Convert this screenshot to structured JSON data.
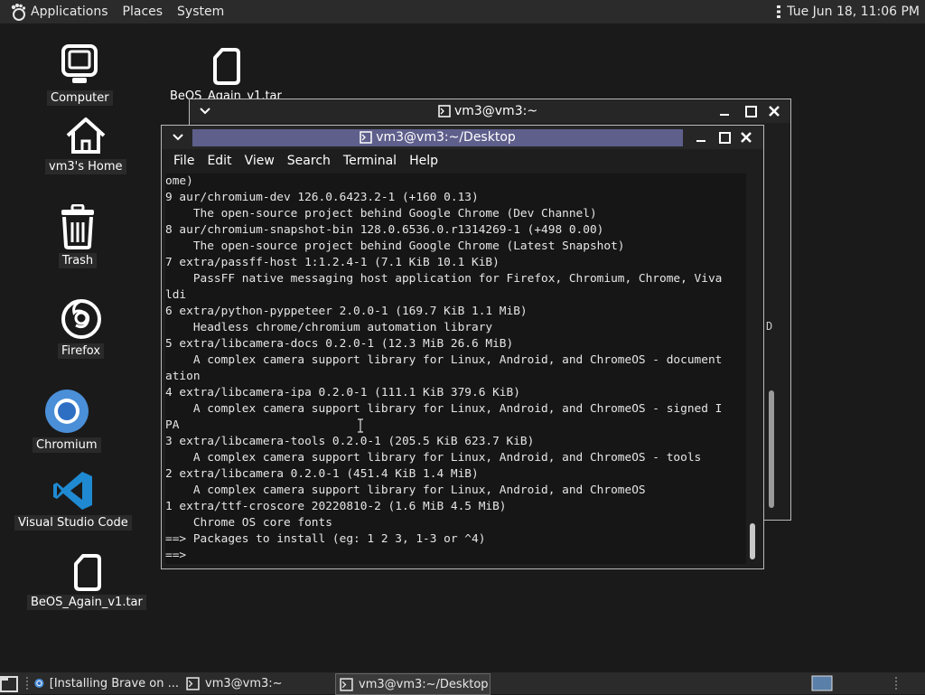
{
  "top_panel": {
    "menus": [
      "Applications",
      "Places",
      "System"
    ],
    "clock": "Tue Jun 18, 11:06 PM"
  },
  "desktop_icons": [
    {
      "label": "Computer",
      "icon": "computer-icon"
    },
    {
      "label": "BeOS_Again_v1.tar",
      "icon": "archive-file-icon"
    },
    {
      "label": "vm3's Home",
      "icon": "home-folder-icon"
    },
    {
      "label": "Trash",
      "icon": "trash-icon"
    },
    {
      "label": "Firefox",
      "icon": "firefox-icon"
    },
    {
      "label": "Chromium",
      "icon": "chromium-icon"
    },
    {
      "label": "Visual Studio Code",
      "icon": "vscode-icon"
    },
    {
      "label": "BeOS_Again_v1.tar",
      "icon": "archive-file-icon"
    }
  ],
  "back_window": {
    "title": "vm3@vm3:~",
    "partial_text": "D"
  },
  "front_window": {
    "title": "vm3@vm3:~/Desktop",
    "menu": [
      "File",
      "Edit",
      "View",
      "Search",
      "Terminal",
      "Help"
    ],
    "lines": [
      "ome)",
      "9 aur/chromium-dev 126.0.6423.2-1 (+160 0.13)",
      "    The open-source project behind Google Chrome (Dev Channel)",
      "8 aur/chromium-snapshot-bin 128.0.6536.0.r1314269-1 (+498 0.00)",
      "    The open-source project behind Google Chrome (Latest Snapshot)",
      "7 extra/passff-host 1:1.2.4-1 (7.1 KiB 10.1 KiB)",
      "    PassFF native messaging host application for Firefox, Chromium, Chrome, Viva",
      "ldi",
      "6 extra/python-pyppeteer 2.0.0-1 (169.7 KiB 1.1 MiB)",
      "    Headless chrome/chromium automation library",
      "5 extra/libcamera-docs 0.2.0-1 (12.3 MiB 26.6 MiB)",
      "    A complex camera support library for Linux, Android, and ChromeOS - document",
      "ation",
      "4 extra/libcamera-ipa 0.2.0-1 (111.1 KiB 379.6 KiB)",
      "    A complex camera support library for Linux, Android, and ChromeOS - signed I",
      "PA",
      "3 extra/libcamera-tools 0.2.0-1 (205.5 KiB 623.7 KiB)",
      "    A complex camera support library for Linux, Android, and ChromeOS - tools",
      "2 extra/libcamera 0.2.0-1 (451.4 KiB 1.4 MiB)",
      "    A complex camera support library for Linux, Android, and ChromeOS",
      "1 extra/ttf-croscore 20220810-2 (1.6 MiB 4.5 MiB)",
      "    Chrome OS core fonts",
      "==> Packages to install (eg: 1 2 3, 1-3 or ^4)",
      "==>"
    ]
  },
  "taskbar": {
    "tasks": [
      {
        "label": "[Installing Brave on ...",
        "icon": "chromium-icon"
      },
      {
        "label": "vm3@vm3:~",
        "icon": "terminal-icon"
      },
      {
        "label": "vm3@vm3:~/Desktop",
        "icon": "terminal-icon",
        "active": true
      }
    ]
  }
}
